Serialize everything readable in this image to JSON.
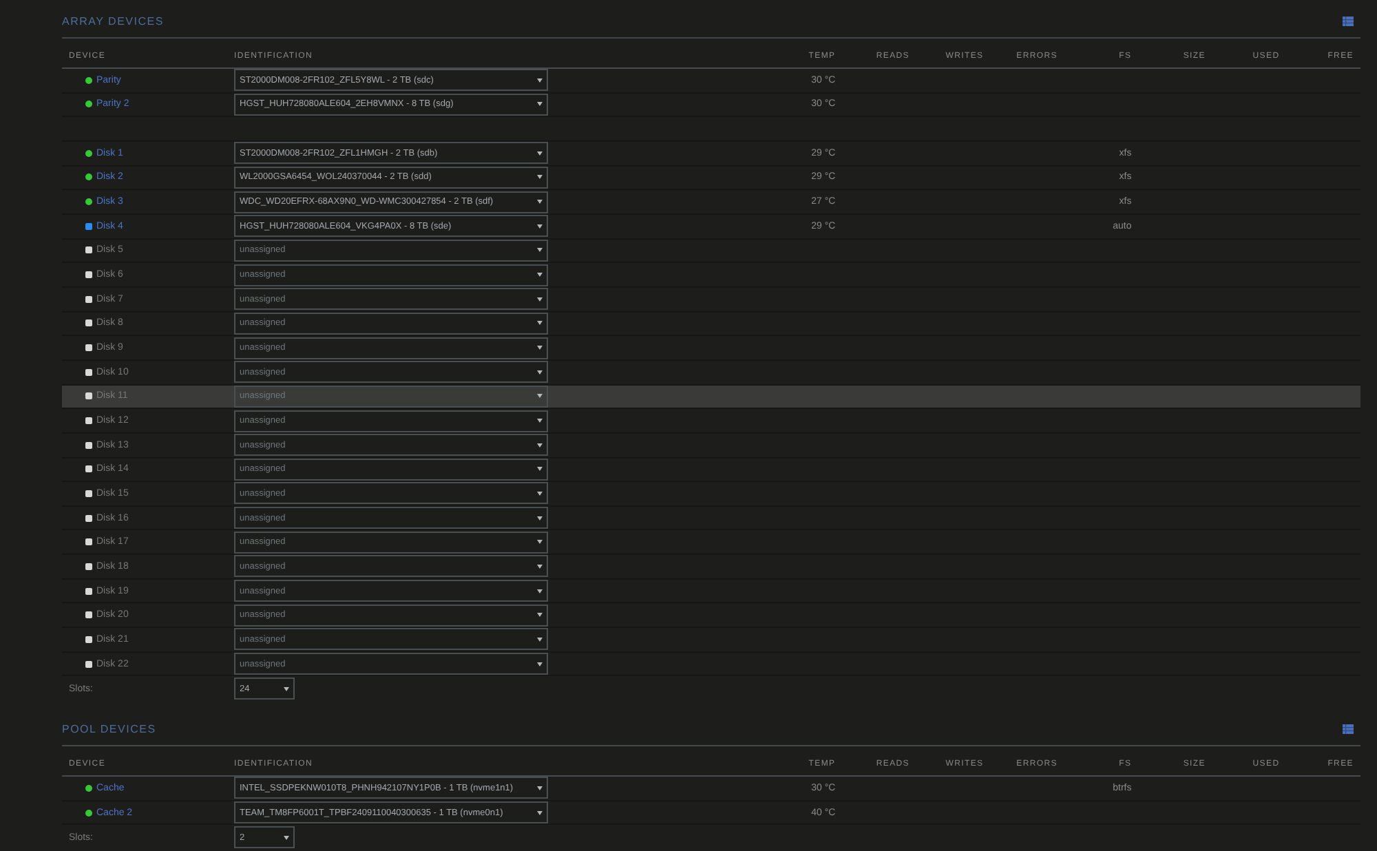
{
  "array_devices": {
    "title": "ARRAY DEVICES",
    "columns": [
      "DEVICE",
      "IDENTIFICATION",
      "TEMP",
      "READS",
      "WRITES",
      "ERRORS",
      "FS",
      "SIZE",
      "USED",
      "FREE"
    ],
    "row_groups": [
      [
        {
          "device": "Parity",
          "kind": "online",
          "color": "#36c836",
          "identification": "ST2000DM008-2FR102_ZFL5Y8WL - 2 TB (sdc)",
          "temp": "30 °C",
          "highlighted": false
        },
        {
          "device": "Parity 2",
          "kind": "online",
          "color": "#36c836",
          "identification": "HGST_HUH728080ALE604_2EH8VMNX - 8 TB (sdg)",
          "temp": "30 °C",
          "highlighted": false
        }
      ],
      [
        {
          "device": "Disk 1",
          "kind": "online",
          "color": "#36c836",
          "identification": "ST2000DM008-2FR102_ZFL1HMGH - 2 TB (sdb)",
          "temp": "29 °C",
          "fs": "xfs",
          "highlighted": false
        },
        {
          "device": "Disk 2",
          "kind": "online",
          "color": "#36c836",
          "identification": "WL2000GSA6454_WOL240370044 - 2 TB (sdd)",
          "temp": "29 °C",
          "fs": "xfs",
          "highlighted": false
        },
        {
          "device": "Disk 3",
          "kind": "online",
          "color": "#36c836",
          "identification": "WDC_WD20EFRX-68AX9N0_WD-WMC300427854 - 2 TB (sdf)",
          "temp": "27 °C",
          "fs": "xfs",
          "highlighted": false
        },
        {
          "device": "Disk 4",
          "kind": "new",
          "color": "#2a8cf2",
          "identification": "HGST_HUH728080ALE604_VKG4PA0X - 8 TB (sde)",
          "temp": "29 °C",
          "fs": "auto",
          "highlighted": false
        },
        {
          "device": "Disk 5",
          "kind": "empty",
          "color": "#d9d9d6",
          "identification": "unassigned",
          "highlighted": false
        },
        {
          "device": "Disk 6",
          "kind": "empty",
          "color": "#d9d9d6",
          "identification": "unassigned",
          "highlighted": false
        },
        {
          "device": "Disk 7",
          "kind": "empty",
          "color": "#d9d9d6",
          "identification": "unassigned",
          "highlighted": false
        },
        {
          "device": "Disk 8",
          "kind": "empty",
          "color": "#d9d9d6",
          "identification": "unassigned",
          "highlighted": false
        },
        {
          "device": "Disk 9",
          "kind": "empty",
          "color": "#d9d9d6",
          "identification": "unassigned",
          "highlighted": false
        },
        {
          "device": "Disk 10",
          "kind": "empty",
          "color": "#d9d9d6",
          "identification": "unassigned",
          "highlighted": false
        },
        {
          "device": "Disk 11",
          "kind": "empty",
          "color": "#d9d9d6",
          "identification": "unassigned",
          "highlighted": true
        },
        {
          "device": "Disk 12",
          "kind": "empty",
          "color": "#d9d9d6",
          "identification": "unassigned",
          "highlighted": false
        },
        {
          "device": "Disk 13",
          "kind": "empty",
          "color": "#d9d9d6",
          "identification": "unassigned",
          "highlighted": false
        },
        {
          "device": "Disk 14",
          "kind": "empty",
          "color": "#d9d9d6",
          "identification": "unassigned",
          "highlighted": false
        },
        {
          "device": "Disk 15",
          "kind": "empty",
          "color": "#d9d9d6",
          "identification": "unassigned",
          "highlighted": false
        },
        {
          "device": "Disk 16",
          "kind": "empty",
          "color": "#d9d9d6",
          "identification": "unassigned",
          "highlighted": false
        },
        {
          "device": "Disk 17",
          "kind": "empty",
          "color": "#d9d9d6",
          "identification": "unassigned",
          "highlighted": false
        },
        {
          "device": "Disk 18",
          "kind": "empty",
          "color": "#d9d9d6",
          "identification": "unassigned",
          "highlighted": false
        },
        {
          "device": "Disk 19",
          "kind": "empty",
          "color": "#d9d9d6",
          "identification": "unassigned",
          "highlighted": false
        },
        {
          "device": "Disk 20",
          "kind": "empty",
          "color": "#d9d9d6",
          "identification": "unassigned",
          "highlighted": false
        },
        {
          "device": "Disk 21",
          "kind": "empty",
          "color": "#d9d9d6",
          "identification": "unassigned",
          "highlighted": false
        },
        {
          "device": "Disk 22",
          "kind": "empty",
          "color": "#d9d9d6",
          "identification": "unassigned",
          "highlighted": false
        }
      ]
    ],
    "slots": {
      "label": "Slots:",
      "value": "24"
    }
  },
  "pool_devices": {
    "title": "POOL DEVICES",
    "columns": [
      "DEVICE",
      "IDENTIFICATION",
      "TEMP",
      "READS",
      "WRITES",
      "ERRORS",
      "FS",
      "SIZE",
      "USED",
      "FREE"
    ],
    "row_groups": [
      [
        {
          "device": "Cache",
          "kind": "online",
          "color": "#36c836",
          "identification": "INTEL_SSDPEKNW010T8_PHNH942107NY1P0B - 1 TB (nvme1n1)",
          "temp": "30 °C",
          "fs": "btrfs",
          "highlighted": false
        },
        {
          "device": "Cache 2",
          "kind": "online",
          "color": "#36c836",
          "identification": "TEAM_TM8FP6001T_TPBF2409110040300635 - 1 TB (nvme0n1)",
          "temp": "40 °C",
          "highlighted": false
        }
      ]
    ],
    "slots": {
      "label": "Slots:",
      "value": "2"
    }
  }
}
